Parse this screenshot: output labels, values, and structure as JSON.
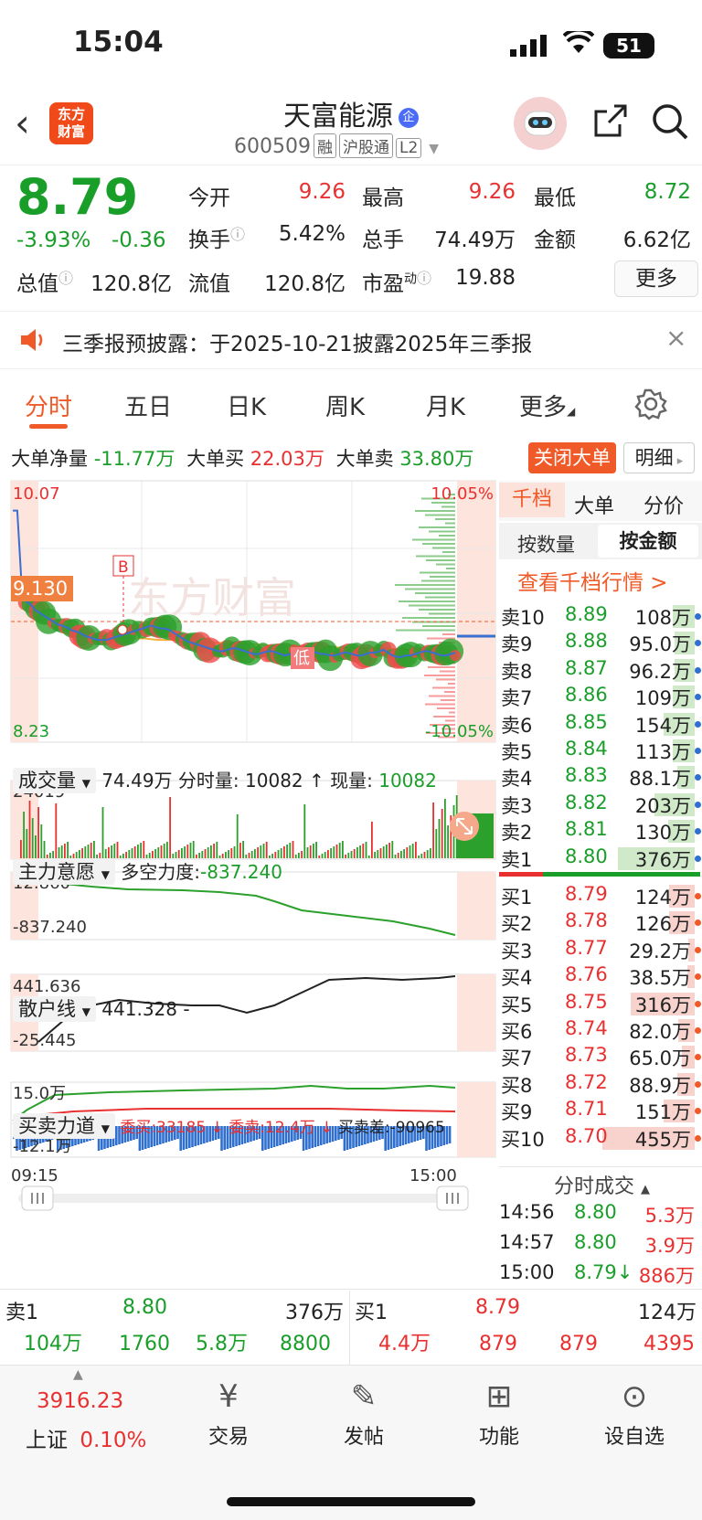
{
  "status": {
    "time": "15:04",
    "battery": "51"
  },
  "header": {
    "logo_line1": "东方",
    "logo_line2": "财富",
    "title": "天富能源",
    "code": "600509",
    "tags": [
      "融",
      "沪股通",
      "L2"
    ]
  },
  "quote": {
    "price": "8.79",
    "pct": "-3.93%",
    "chg": "-0.36",
    "labels": {
      "open": "今开",
      "high": "最高",
      "low": "最低",
      "turnover": "换手",
      "vol": "总手",
      "amount": "金额",
      "cap": "总值",
      "float": "流值",
      "pe": "市盈"
    },
    "values": {
      "open": "9.26",
      "high": "9.26",
      "low": "8.72",
      "turnover": "5.42%",
      "vol": "74.49万",
      "amount": "6.62亿",
      "cap": "120.8亿",
      "float": "120.8亿",
      "pe": "19.88"
    },
    "pe_sup": "动",
    "more": "更多"
  },
  "notice": {
    "text": "三季报预披露：于2025-10-21披露2025年三季报"
  },
  "tabs": [
    "分时",
    "五日",
    "日K",
    "周K",
    "月K",
    "更多"
  ],
  "bigorder": {
    "net_label": "大单净量",
    "net": "-11.77万",
    "buy_label": "大单买",
    "buy": "22.03万",
    "sell_label": "大单卖",
    "sell": "33.80万",
    "close_btn": "关闭大单",
    "detail_btn": "明细"
  },
  "chart": {
    "y_high": "10.07",
    "y_low": "8.23",
    "pct_high": "10.05%",
    "pct_low": "-10.05%",
    "cur_price": "9.130",
    "marker_b": "B",
    "marker_low": "低",
    "watermark": "东方财富",
    "series": [
      9.86,
      9.86,
      9.32,
      9.22,
      9.2,
      9.16,
      9.14,
      9.12,
      9.1,
      9.08,
      9.06,
      9.05,
      9.04,
      9.02,
      9.01,
      9.0,
      8.98,
      8.97,
      8.96,
      8.95,
      8.95,
      8.95,
      8.96,
      8.97,
      8.98,
      8.99,
      9.0,
      9.01,
      9.02,
      9.03,
      9.04,
      9.05,
      9.04,
      9.03,
      9.03,
      9.02,
      9.0,
      8.98,
      8.96,
      8.94,
      8.93,
      8.92,
      8.91,
      8.9,
      8.89,
      8.88,
      8.87,
      8.87,
      8.88,
      8.89,
      8.89,
      8.88,
      8.87,
      8.86,
      8.85,
      8.85,
      8.86,
      8.87,
      8.87,
      8.86,
      8.85,
      8.84,
      8.85,
      8.86,
      8.87,
      8.88,
      8.88,
      8.87,
      8.86,
      8.85,
      8.85,
      8.84,
      8.84,
      8.85,
      8.86,
      8.86,
      8.85,
      8.84,
      8.84,
      8.85,
      8.86,
      8.86,
      8.87,
      8.88,
      8.86,
      8.84,
      8.83,
      8.83,
      8.84,
      8.84,
      8.85,
      8.86,
      8.87,
      8.87,
      8.86,
      8.85,
      8.84,
      8.84,
      8.85,
      8.86
    ],
    "avg": [
      9.1,
      9.05,
      9.02,
      9.0,
      8.99,
      8.98,
      8.97,
      8.96,
      8.96,
      8.95,
      8.95,
      8.94,
      8.94,
      8.93,
      8.93,
      8.92,
      8.92,
      8.91,
      8.91,
      8.91,
      8.9,
      8.9,
      8.9,
      8.89,
      8.89,
      8.89,
      8.89,
      8.88,
      8.88,
      8.88,
      8.88,
      8.88
    ]
  },
  "volume": {
    "label": "成交量",
    "total": "74.49万",
    "split_label": "分时量:",
    "split": "10082",
    "cur_label": "现量:",
    "cur": "10082",
    "ymax": "24019"
  },
  "main_force": {
    "label": "主力意愿",
    "ls_label": "多空力度:",
    "ls": "-837.240",
    "ytop": "12.860",
    "ybot": "-837.240"
  },
  "retail": {
    "label": "散户线",
    "value": "441.328 -",
    "ytop": "441.636",
    "ybot": "-25.445"
  },
  "bsforce": {
    "label": "买卖力道",
    "buy": "委买:33185",
    "sell": "委卖:12.4万",
    "diff": "买卖差:-90965",
    "ytop": "15.0万",
    "ybot": "-12.1万"
  },
  "timeaxis": {
    "start": "09:15",
    "end": "15:00"
  },
  "orderbook": {
    "tab1": "千档",
    "tab2": "大单",
    "tab3": "分价",
    "sub1": "按数量",
    "sub2": "按金额",
    "link": "查看千档行情 >",
    "asks": [
      {
        "l": "卖10",
        "p": "8.89",
        "v": "108",
        "f": 0.2
      },
      {
        "l": "卖9",
        "p": "8.88",
        "v": "95.0",
        "f": 0.18
      },
      {
        "l": "卖8",
        "p": "8.87",
        "v": "96.2",
        "f": 0.18
      },
      {
        "l": "卖7",
        "p": "8.86",
        "v": "109",
        "f": 0.2
      },
      {
        "l": "卖6",
        "p": "8.85",
        "v": "154",
        "f": 0.28
      },
      {
        "l": "卖5",
        "p": "8.84",
        "v": "113",
        "f": 0.2
      },
      {
        "l": "卖4",
        "p": "8.83",
        "v": "88.1",
        "f": 0.16
      },
      {
        "l": "卖3",
        "p": "8.82",
        "v": "203",
        "f": 0.37
      },
      {
        "l": "卖2",
        "p": "8.81",
        "v": "130",
        "f": 0.24
      },
      {
        "l": "卖1",
        "p": "8.80",
        "v": "376",
        "f": 0.7
      }
    ],
    "bids": [
      {
        "l": "买1",
        "p": "8.79",
        "v": "124",
        "f": 0.23
      },
      {
        "l": "买2",
        "p": "8.78",
        "v": "126",
        "f": 0.23
      },
      {
        "l": "买3",
        "p": "8.77",
        "v": "29.2",
        "f": 0.06
      },
      {
        "l": "买4",
        "p": "8.76",
        "v": "38.5",
        "f": 0.07
      },
      {
        "l": "买5",
        "p": "8.75",
        "v": "316",
        "f": 0.58
      },
      {
        "l": "买6",
        "p": "8.74",
        "v": "82.0",
        "f": 0.15
      },
      {
        "l": "买7",
        "p": "8.73",
        "v": "65.0",
        "f": 0.12
      },
      {
        "l": "买8",
        "p": "8.72",
        "v": "88.9",
        "f": 0.16
      },
      {
        "l": "买9",
        "p": "8.71",
        "v": "151",
        "f": 0.28
      },
      {
        "l": "买10",
        "p": "8.70",
        "v": "455",
        "f": 0.84
      }
    ],
    "unit": "万",
    "trades_label": "分时成交",
    "trades": [
      {
        "t": "14:56",
        "p": "8.80",
        "v": "5.3万"
      },
      {
        "t": "14:57",
        "p": "8.80",
        "v": "3.9万"
      },
      {
        "t": "15:00",
        "p": "8.79↓",
        "v": "886万"
      }
    ]
  },
  "bottomq": {
    "s1": "卖1",
    "s1p": "8.80",
    "s1v": "376万",
    "b1": "买1",
    "b1p": "8.79",
    "b1v": "124万",
    "row_left": [
      "104万",
      "1760",
      "5.8万",
      "8800"
    ],
    "row_right": [
      "4.4万",
      "879",
      "879",
      "4395"
    ]
  },
  "nav": {
    "index_val": "3916.23",
    "index_name": "上证",
    "index_pct": "0.10%",
    "items": [
      "交易",
      "发帖",
      "功能",
      "设自选"
    ]
  }
}
